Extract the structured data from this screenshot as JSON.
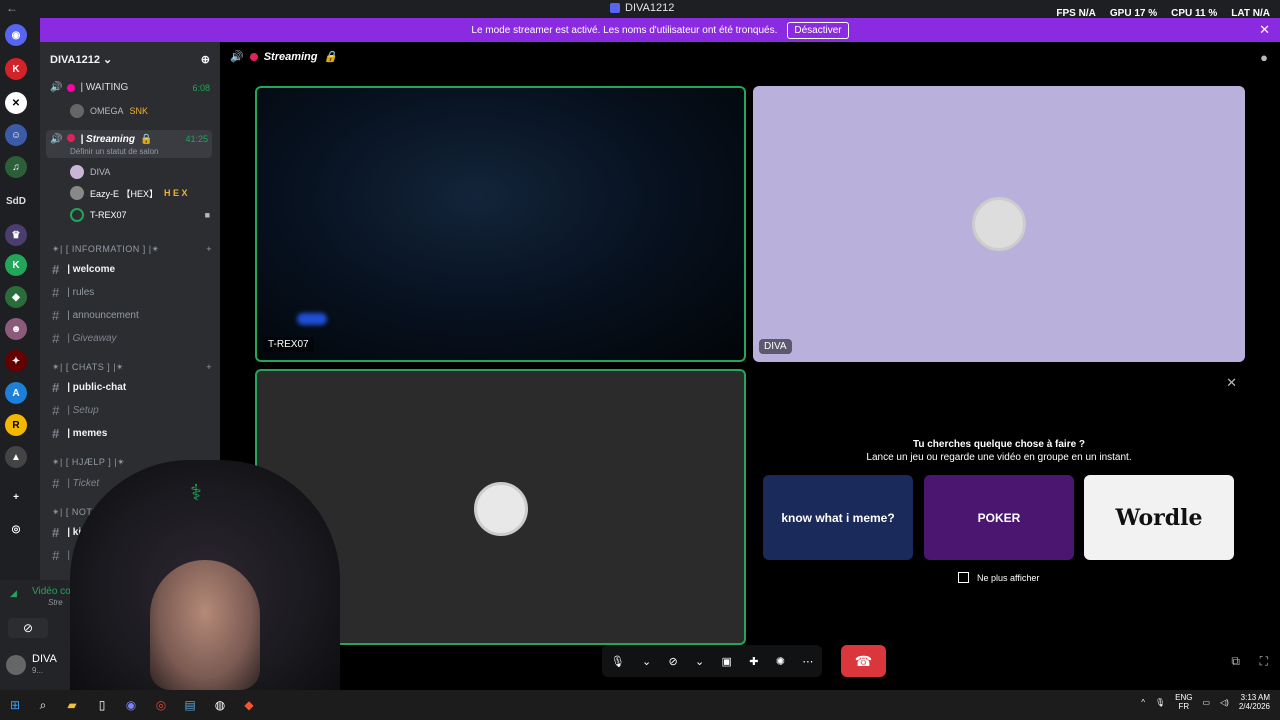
{
  "window": {
    "title": "DIVA1212",
    "back": "←"
  },
  "stats": {
    "fps_label": "FPS",
    "fps": "N/A",
    "gpu_label": "GPU",
    "gpu": "17 %",
    "cpu_label": "CPU",
    "cpu": "11 %",
    "lat_label": "LAT",
    "lat": "N/A"
  },
  "banner": {
    "text": "Le mode streamer est activé. Les noms d'utilisateur ont été tronqués.",
    "button": "Désactiver"
  },
  "servers": {
    "labels": [
      "SdD"
    ],
    "badges": [
      "6",
      "49",
      "16",
      "3",
      "2"
    ]
  },
  "sidebar": {
    "server_name": "DIVA1212",
    "voice": [
      {
        "name": "| WAITING",
        "time": "6:08",
        "users": [
          "OMEGA",
          "SNK"
        ]
      },
      {
        "name": "| Streaming",
        "time": "41:25",
        "status": "Définir un statut de salon",
        "users": [
          "DIVA",
          "Eazy-E 【HEX】",
          "T-REX07"
        ],
        "tag": "H E X"
      }
    ],
    "categories": [
      {
        "name": "✴| [ INFORMATION ] |✴",
        "channels": [
          {
            "name": "| welcome",
            "style": "active"
          },
          {
            "name": "| rules",
            "style": "normal"
          },
          {
            "name": "| announcement",
            "style": "normal"
          },
          {
            "name": "| Giveaway",
            "style": "muted"
          }
        ]
      },
      {
        "name": "✴| [ CHATS ] |✴",
        "channels": [
          {
            "name": "| public-chat",
            "style": "active"
          },
          {
            "name": "| Setup",
            "style": "muted"
          },
          {
            "name": "| memes",
            "style": "active"
          }
        ]
      },
      {
        "name": "✴| [ HJÆLP ] |✴",
        "channels": [
          {
            "name": "| Ticket",
            "style": "muted"
          }
        ]
      },
      {
        "name": "✴| [ NOTIFICATION",
        "channels": [
          {
            "name": "| kick",
            "style": "active"
          },
          {
            "name": "| Ti",
            "style": "muted"
          }
        ]
      }
    ]
  },
  "voice_panel": {
    "label": "Vidéo co",
    "channel": "Stre"
  },
  "user_panel": {
    "name": "DIVA",
    "status": "9..."
  },
  "call": {
    "channel_name": "Streaming",
    "tiles": [
      "T-REX07",
      "DIVA"
    ]
  },
  "activity": {
    "heading": "Tu cherches quelque chose à faire ?",
    "subheading": "Lance un jeu ou regarde une vidéo en groupe en un instant.",
    "games": [
      "know what i meme?",
      "POKER",
      "Wordle"
    ],
    "checkbox": "Ne plus afficher"
  },
  "taskbar": {
    "lang": "ENG",
    "region": "FR",
    "time": "3:13 AM",
    "date": "2/4/2026"
  },
  "colors": {
    "banner": "#8a2be2",
    "speaking": "#23a55a",
    "hangup": "#da373c",
    "diva_tile": "#b9b0db"
  }
}
